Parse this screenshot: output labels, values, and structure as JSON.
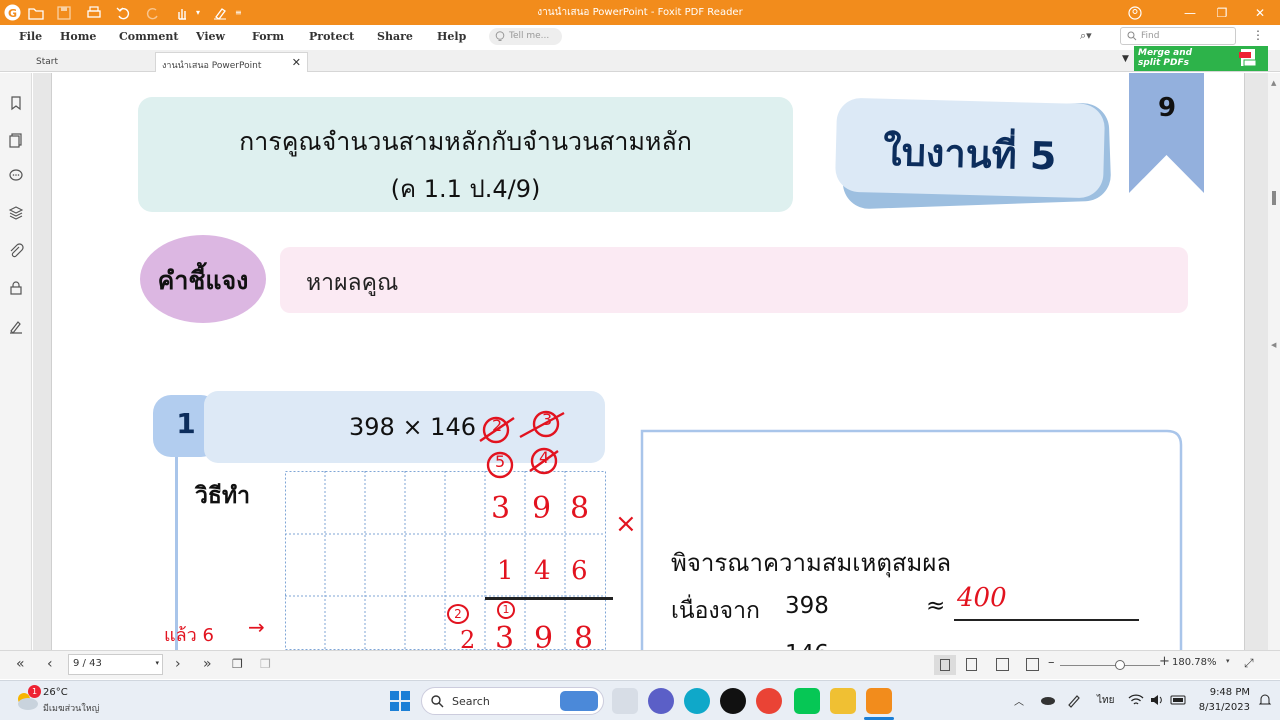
{
  "window": {
    "title": "งานนำเสนอ PowerPoint - Foxit PDF Reader"
  },
  "menu": {
    "file": "File",
    "home": "Home",
    "comment": "Comment",
    "view": "View",
    "form": "Form",
    "protect": "Protect",
    "share": "Share",
    "help": "Help",
    "tell_me": "Tell me...",
    "find": "Find"
  },
  "tabs": [
    {
      "label": "Start"
    },
    {
      "label": "งานนำเสนอ PowerPoint"
    }
  ],
  "banner": {
    "line1": "Merge and",
    "line2": "split PDFs"
  },
  "doc": {
    "title_line1": "การคูณจำนวนสามหลักกับจำนวนสามหลัก",
    "title_line2": "(ค 1.1 ป.4/9)",
    "worksheet": "ใบงานที่ 5",
    "page_badge": "9",
    "instruction_label": "คำชี้แจง",
    "instruction_text": "หาผลคูณ",
    "problem_number": "1",
    "problem": "398 × 146",
    "method_label": "วิธีทำ",
    "reason_title": "พิจารณาความสมเหตุสมผล",
    "reason_line1_label": "เนื่องจาก",
    "reason_line1_value": "398",
    "approx": "≈"
  },
  "handwriting": {
    "digits_top": [
      "3",
      "9",
      "8"
    ],
    "digits_bottom": [
      "1",
      "4",
      "6"
    ],
    "times": "×",
    "carry_top": [
      "2",
      "3"
    ],
    "carry_mid": [
      "5",
      "4"
    ],
    "carry_low": [
      "2",
      "1"
    ],
    "row_partial": [
      "2",
      "3",
      "9",
      "8"
    ],
    "estimate": "400",
    "side_note": "แล้ว 6"
  },
  "status": {
    "page": "9 / 43",
    "zoom": "180.78%"
  },
  "taskbar": {
    "temp": "26°C",
    "weather": "มีเมฆส่วนใหญ่",
    "search": "Search",
    "lang": "ไทย",
    "time": "9:48 PM",
    "date": "8/31/2023",
    "badge": "1"
  }
}
